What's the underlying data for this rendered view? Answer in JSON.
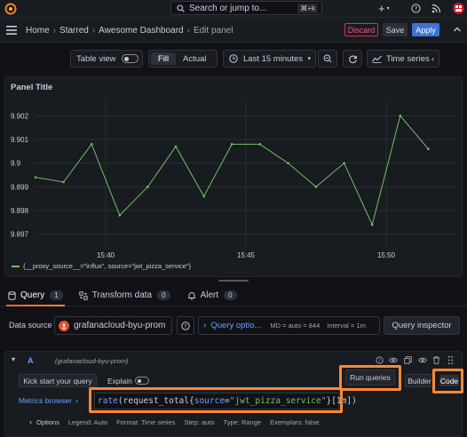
{
  "topbar": {
    "search_placeholder": "Search or jump to...",
    "search_shortcut": "⌘+k",
    "plus_label": "+"
  },
  "breadcrumb": {
    "items": [
      "Home",
      "Starred",
      "Awesome Dashboard",
      "Edit panel"
    ],
    "separator": "›"
  },
  "toolbar": {
    "discard_label": "Discard",
    "save_label": "Save",
    "apply_label": "Apply"
  },
  "panel_controls": {
    "table_view_label": "Table view",
    "fill_label": "Fill",
    "actual_label": "Actual",
    "time_range_label": "Last 15 minutes",
    "visualization_label": "Time series"
  },
  "panel": {
    "title": "Panel Title",
    "legend_label": "{__proxy_source__=\"influx\", source=\"jwt_pizza_service\"}"
  },
  "chart_data": {
    "type": "line",
    "title": "Panel Title",
    "x": [
      "15:37:30",
      "15:38:30",
      "15:39:30",
      "15:40:30",
      "15:41:30",
      "15:42:30",
      "15:43:30",
      "15:44:30",
      "15:45:30",
      "15:46:30",
      "15:47:30",
      "15:48:30",
      "15:49:30",
      "15:50:30",
      "15:51:30",
      "15:52:30"
    ],
    "x_ticks": [
      "15:40",
      "15:45",
      "15:50"
    ],
    "y_ticks": [
      9.897,
      9.898,
      9.899,
      9.9,
      9.901,
      9.902
    ],
    "y_tick_labels": [
      "9.897",
      "9.898",
      "9.899",
      "9.9",
      "9.901",
      "9.902"
    ],
    "ylim": [
      9.8965,
      9.9025
    ],
    "series": [
      {
        "name": "{__proxy_source__=\"influx\", source=\"jwt_pizza_service\"}",
        "color": "#73bf69",
        "values": [
          9.8994,
          9.8992,
          9.9008,
          9.8978,
          9.899,
          9.9007,
          9.8986,
          9.9008,
          9.9008,
          9.9,
          9.899,
          9.9,
          9.8974,
          9.902,
          9.9006
        ]
      }
    ],
    "grid": true,
    "legend_position": "bottom-left"
  },
  "query_tabs": [
    {
      "label": "Query",
      "count": "1"
    },
    {
      "label": "Transform data",
      "count": "0"
    },
    {
      "label": "Alert",
      "count": "0"
    }
  ],
  "datasource": {
    "label": "Data source",
    "value": "grafanacloud-byu-prom",
    "query_options_label": "Query optio...",
    "md_text": "MD = auto = 844",
    "interval_text": "Interval = 1m",
    "query_inspector_label": "Query inspector"
  },
  "query_row": {
    "ref_id": "A",
    "source_name": "(grafanacloud-byu-prom)",
    "kick_start_label": "Kick start your query",
    "explain_label": "Explain",
    "run_queries_label": "Run queries",
    "builder_label": "Builder",
    "code_label": "Code",
    "metrics_browser_label": "Metrics browser",
    "query_fn": "rate",
    "query_metric": "request_total",
    "query_label_key": "source",
    "query_label_value": "\"jwt_pizza_service\"",
    "query_range": "[1m]",
    "query_close": ")"
  },
  "options": {
    "label": "Options",
    "legend": "Legend: Auto",
    "format": "Format: Time series",
    "step": "Step: auto",
    "type": "Type: Range",
    "exemplars": "Exemplars: false"
  },
  "colors": {
    "accent": "#3d71d9",
    "discard": "#e02f44",
    "highlight": "#ff8833",
    "series": "#73bf69"
  }
}
